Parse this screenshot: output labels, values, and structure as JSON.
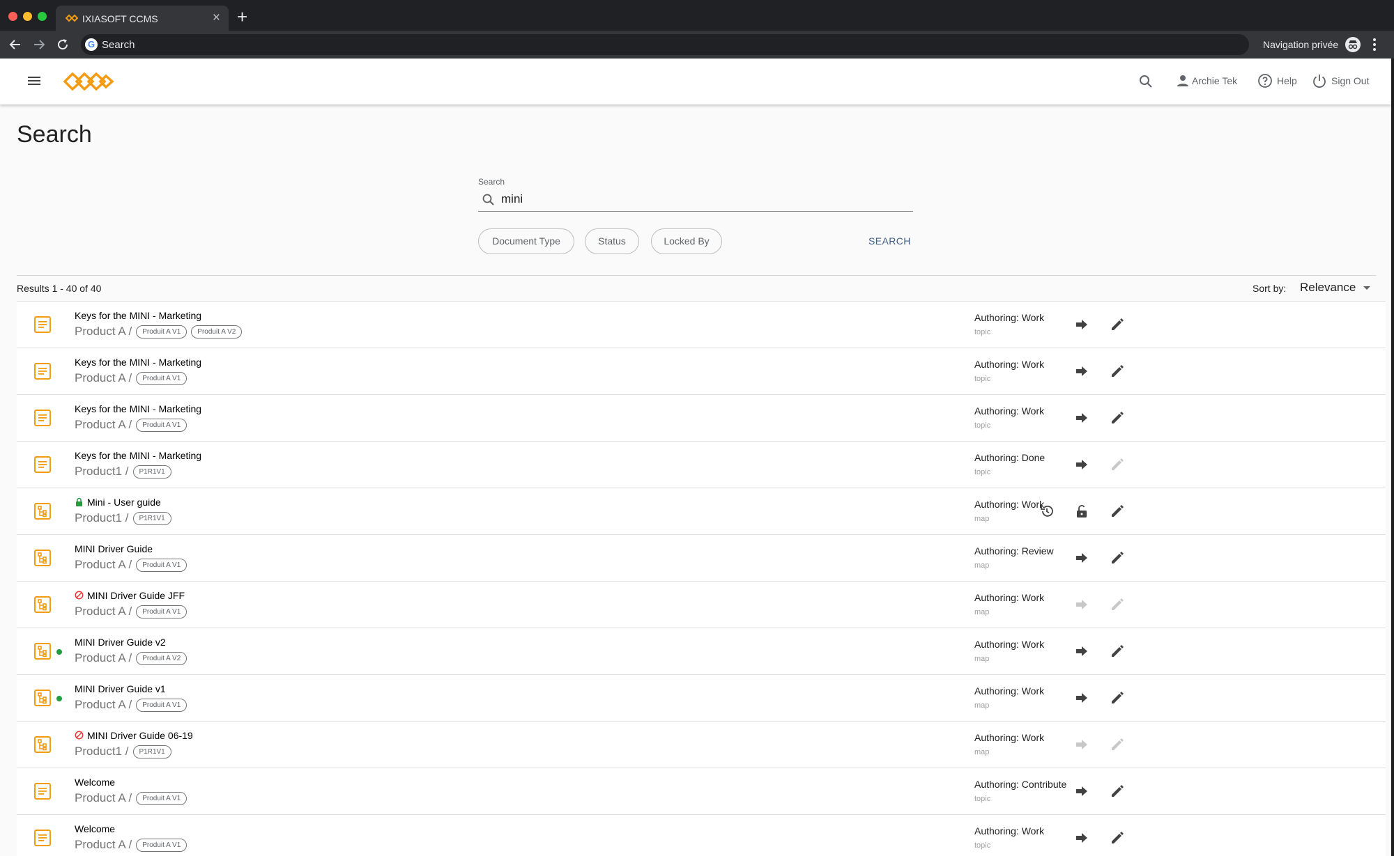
{
  "browser": {
    "tab_title": "IXIASOFT CCMS",
    "tab_close": "×",
    "new_tab": "+",
    "omnibox_text": "Search",
    "incognito_label": "Navigation privée"
  },
  "header": {
    "user_name": "Archie Tek",
    "help_label": "Help",
    "signout_label": "Sign Out",
    "brand_color": "#f39c12"
  },
  "page": {
    "title": "Search",
    "search_label": "Search",
    "search_value": "mini",
    "filters": [
      "Document Type",
      "Status",
      "Locked By"
    ],
    "search_button": "SEARCH",
    "results_count": "Results 1 - 40 of 40",
    "sort_label": "Sort by:",
    "sort_value": "Relevance"
  },
  "results": [
    {
      "title": "Keys for the MINI - Marketing",
      "product": "Product A /",
      "branches": [
        "Produit A V1",
        "Produit A V2"
      ],
      "status": "Authoring: Work",
      "doctype": "topic",
      "icon": "topic-icon",
      "mark": "",
      "dot": false,
      "actions": [
        "open-arrow-icon",
        "edit-pencil-icon"
      ],
      "disabled": []
    },
    {
      "title": "Keys for the MINI - Marketing",
      "product": "Product A /",
      "branches": [
        "Produit A V1"
      ],
      "status": "Authoring: Work",
      "doctype": "topic",
      "icon": "topic-icon",
      "mark": "",
      "dot": false,
      "actions": [
        "open-arrow-icon",
        "edit-pencil-icon"
      ],
      "disabled": []
    },
    {
      "title": "Keys for the MINI - Marketing",
      "product": "Product A /",
      "branches": [
        "Produit A V1"
      ],
      "status": "Authoring: Work",
      "doctype": "topic",
      "icon": "topic-icon",
      "mark": "",
      "dot": false,
      "actions": [
        "open-arrow-icon",
        "edit-pencil-icon"
      ],
      "disabled": []
    },
    {
      "title": "Keys for the MINI - Marketing",
      "product": "Product1 /",
      "branches": [
        "P1R1V1"
      ],
      "status": "Authoring: Done",
      "doctype": "topic",
      "icon": "topic-icon",
      "mark": "",
      "dot": false,
      "actions": [
        "open-arrow-icon",
        "edit-pencil-icon"
      ],
      "disabled": [
        "edit-pencil-icon"
      ]
    },
    {
      "title": "Mini - User guide",
      "product": "Product1 /",
      "branches": [
        "P1R1V1"
      ],
      "status": "Authoring: Work",
      "doctype": "map",
      "icon": "map-icon",
      "mark": "lock",
      "dot": false,
      "actions": [
        "history-icon",
        "unlock-icon",
        "edit-pencil-icon"
      ],
      "disabled": []
    },
    {
      "title": "MINI Driver Guide",
      "product": "Product A /",
      "branches": [
        "Produit A V1"
      ],
      "status": "Authoring: Review",
      "doctype": "map",
      "icon": "map-icon",
      "mark": "",
      "dot": false,
      "actions": [
        "open-arrow-icon",
        "edit-pencil-icon"
      ],
      "disabled": []
    },
    {
      "title": "MINI Driver Guide JFF",
      "product": "Product A /",
      "branches": [
        "Produit A V1"
      ],
      "status": "Authoring: Work",
      "doctype": "map",
      "icon": "map-icon",
      "mark": "blocked",
      "dot": false,
      "actions": [
        "open-arrow-icon",
        "edit-pencil-icon"
      ],
      "disabled": [
        "open-arrow-icon",
        "edit-pencil-icon"
      ]
    },
    {
      "title": "MINI Driver Guide v2",
      "product": "Product A /",
      "branches": [
        "Produit A V2"
      ],
      "status": "Authoring: Work",
      "doctype": "map",
      "icon": "map-icon",
      "mark": "",
      "dot": true,
      "actions": [
        "open-arrow-icon",
        "edit-pencil-icon"
      ],
      "disabled": []
    },
    {
      "title": "MINI Driver Guide v1",
      "product": "Product A /",
      "branches": [
        "Produit A V1"
      ],
      "status": "Authoring: Work",
      "doctype": "map",
      "icon": "map-icon",
      "mark": "",
      "dot": true,
      "actions": [
        "open-arrow-icon",
        "edit-pencil-icon"
      ],
      "disabled": []
    },
    {
      "title": "MINI Driver Guide 06-19",
      "product": "Product1 /",
      "branches": [
        "P1R1V1"
      ],
      "status": "Authoring: Work",
      "doctype": "map",
      "icon": "map-icon",
      "mark": "blocked",
      "dot": false,
      "actions": [
        "open-arrow-icon",
        "edit-pencil-icon"
      ],
      "disabled": [
        "open-arrow-icon",
        "edit-pencil-icon"
      ]
    },
    {
      "title": "Welcome",
      "product": "Product A /",
      "branches": [
        "Produit A V1"
      ],
      "status": "Authoring: Contribute",
      "doctype": "topic",
      "icon": "topic-icon",
      "mark": "",
      "dot": false,
      "actions": [
        "open-arrow-icon",
        "edit-pencil-icon"
      ],
      "disabled": []
    },
    {
      "title": "Welcome",
      "product": "Product A /",
      "branches": [
        "Produit A V1"
      ],
      "status": "Authoring: Work",
      "doctype": "topic",
      "icon": "topic-icon",
      "mark": "",
      "dot": false,
      "actions": [
        "open-arrow-icon",
        "edit-pencil-icon"
      ],
      "disabled": []
    }
  ]
}
